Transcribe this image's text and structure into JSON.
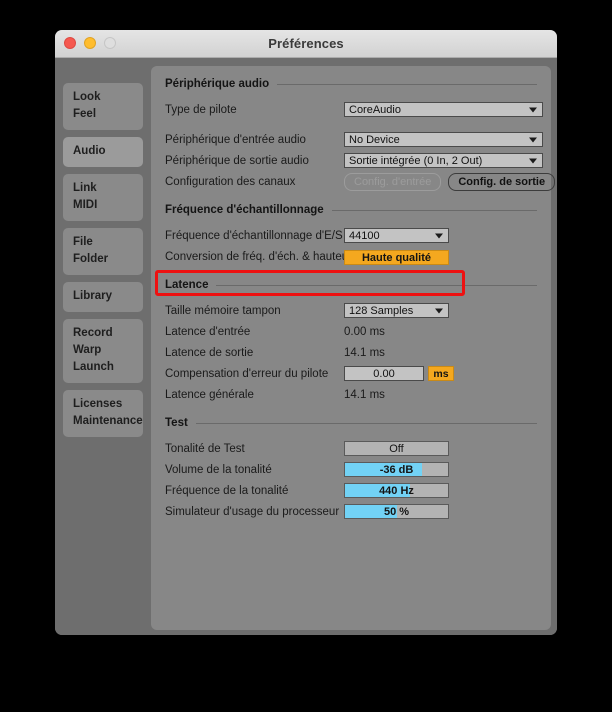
{
  "window": {
    "title": "Préférences",
    "traffic_lights": [
      "close-button",
      "minimize-button",
      "zoom-button"
    ]
  },
  "sidebar": {
    "groups": [
      {
        "selected": false,
        "lines": [
          "Look",
          "Feel"
        ]
      },
      {
        "selected": true,
        "lines": [
          "Audio"
        ]
      },
      {
        "selected": false,
        "lines": [
          "Link",
          "MIDI"
        ]
      },
      {
        "selected": false,
        "lines": [
          "File",
          "Folder"
        ]
      },
      {
        "selected": false,
        "lines": [
          "Library"
        ]
      },
      {
        "selected": false,
        "lines": [
          "Record",
          "Warp",
          "Launch"
        ]
      },
      {
        "selected": false,
        "lines": [
          "Licenses",
          "Maintenance"
        ]
      }
    ]
  },
  "sections": {
    "audio_device": {
      "header": "Périphérique audio",
      "driver_type_label": "Type de pilote",
      "driver_type_value": "CoreAudio",
      "input_device_label": "Périphérique d'entrée audio",
      "input_device_value": "No Device",
      "output_device_label": "Périphérique de sortie audio",
      "output_device_value": "Sortie intégrée (0 In, 2 Out)",
      "channel_config_label": "Configuration des canaux",
      "input_config_button": "Config. d'entrée",
      "output_config_button": "Config. de sortie"
    },
    "sample_rate": {
      "header": "Fréquence d'échantillonnage",
      "io_rate_label": "Fréquence d'échantillonnage d'E/S",
      "io_rate_value": "44100",
      "conversion_label": "Conversion de fréq. d'éch. & hauteur",
      "conversion_value": "Haute qualité"
    },
    "latency": {
      "header": "Latence",
      "buffer_size_label": "Taille mémoire tampon",
      "buffer_size_value": "128 Samples",
      "input_latency_label": "Latence d'entrée",
      "input_latency_value": "0.00 ms",
      "output_latency_label": "Latence de sortie",
      "output_latency_value": "14.1 ms",
      "driver_error_label": "Compensation d'erreur du pilote",
      "driver_error_value": "0.00",
      "driver_error_unit": "ms",
      "overall_latency_label": "Latence générale",
      "overall_latency_value": "14.1 ms"
    },
    "test": {
      "header": "Test",
      "test_tone_label": "Tonalité de Test",
      "test_tone_value": "Off",
      "test_tone_fill": 0,
      "tone_volume_label": "Volume de la tonalité",
      "tone_volume_value": "-36 dB",
      "tone_volume_fill": 75,
      "tone_freq_label": "Fréquence de la tonalité",
      "tone_freq_value": "440 Hz",
      "tone_freq_fill": 63,
      "cpu_sim_label": "Simulateur d'usage du processeur",
      "cpu_sim_value": "50 %",
      "cpu_sim_fill": 50
    }
  },
  "annotation": {
    "highlight_color": "#ee1111",
    "highlight_target": "buffer-size-row"
  },
  "colors": {
    "panel_bg": "#878787",
    "window_bg": "#6e6e6e",
    "accent_orange": "#f4a81f",
    "accent_cyan": "#72d2f5",
    "sidebar_item": "#8a8a8a",
    "sidebar_item_selected": "#9b9b9b"
  }
}
